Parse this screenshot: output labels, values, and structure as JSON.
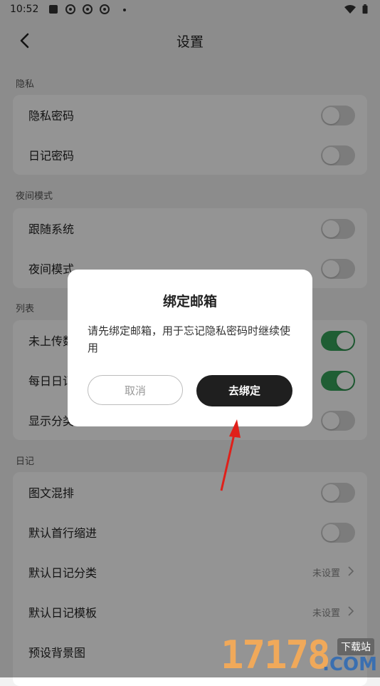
{
  "status_bar": {
    "time": "10:52"
  },
  "header": {
    "title": "设置"
  },
  "sections": {
    "privacy": {
      "label": "隐私",
      "items": [
        {
          "label": "隐私密码",
          "on": false
        },
        {
          "label": "日记密码",
          "on": false
        }
      ]
    },
    "night": {
      "label": "夜间模式",
      "items": [
        {
          "label": "跟随系统",
          "on": false
        },
        {
          "label": "夜间模式",
          "on": false
        }
      ]
    },
    "list": {
      "label": "列表",
      "items": [
        {
          "label": "未上传数",
          "on": true
        },
        {
          "label": "每日日记",
          "on": true
        },
        {
          "label": "显示分类",
          "on": false
        }
      ]
    },
    "diary": {
      "label": "日记",
      "items": [
        {
          "label": "图文混排",
          "on": false
        },
        {
          "label": "默认首行缩进",
          "on": false
        },
        {
          "label": "默认日记分类",
          "value": "未设置"
        },
        {
          "label": "默认日记模板",
          "value": "未设置"
        },
        {
          "label": "预设背景图"
        }
      ]
    }
  },
  "dialog": {
    "title": "绑定邮箱",
    "message": "请先绑定邮箱，用于忘记隐私密码时继续使用",
    "cancel_label": "取消",
    "confirm_label": "去绑定"
  },
  "watermark": {
    "number": "17178",
    "site_label": "下载站",
    "domain": ".COM"
  },
  "colors": {
    "toggle_on": "#36a35a",
    "toggle_off": "#d6d6d6",
    "primary_button": "#1f1f1f",
    "annotation_arrow": "#e0201a"
  }
}
